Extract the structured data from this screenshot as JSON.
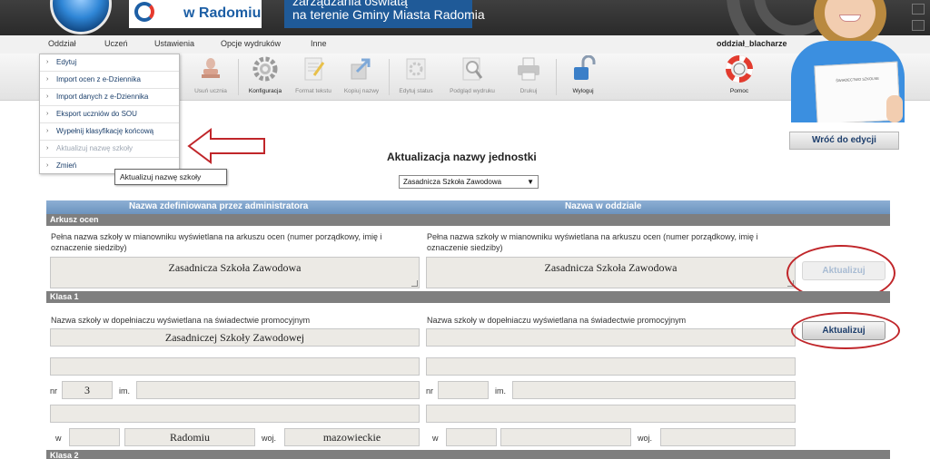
{
  "banner": {
    "logo_text": "w Radomiu",
    "line1": "zarządzania oświatą",
    "line2": "na terenie Gminy Miasta Radomia"
  },
  "menu": {
    "items": [
      "Oddział",
      "Uczeń",
      "Ustawienia",
      "Opcje wydruków",
      "Inne"
    ],
    "user": "oddział_blacharze"
  },
  "toolbar": {
    "tools": [
      {
        "label": "Usuń ucznia",
        "icon": "stamp-icon",
        "enabled": false
      },
      {
        "label": "Konfiguracja",
        "icon": "gear-icon",
        "enabled": true
      },
      {
        "label": "Format tekstu",
        "icon": "text-format-icon",
        "enabled": false
      },
      {
        "label": "Kopiuj nazwy",
        "icon": "copy-arrow-icon",
        "enabled": false
      },
      {
        "label": "Edytuj status",
        "icon": "gear-status-icon",
        "enabled": false
      },
      {
        "label": "Podgląd wydruku",
        "icon": "magnifier-icon",
        "enabled": false
      },
      {
        "label": "Drukuj",
        "icon": "printer-icon",
        "enabled": false
      },
      {
        "label": "Wyloguj",
        "icon": "padlock-icon",
        "enabled": true
      },
      {
        "label": "Pomoc",
        "icon": "lifebuoy-icon",
        "enabled": true
      }
    ]
  },
  "photo": {
    "doc_title": "ŚWIADECTWO SZKOLNE"
  },
  "dropdown": {
    "items": [
      {
        "label": "Edytuj",
        "enabled": true
      },
      {
        "label": "Import ocen z e-Dziennika",
        "enabled": true
      },
      {
        "label": "Import danych z e-Dziennika",
        "enabled": true
      },
      {
        "label": "Eksport uczniów do SOU",
        "enabled": true
      },
      {
        "label": "Wypełnij klasyfikację końcową",
        "enabled": true
      },
      {
        "label": "Aktualizuj nazwę szkoły",
        "enabled": false
      },
      {
        "label": "Zmień",
        "enabled": true
      }
    ],
    "tooltip": "Aktualizuj nazwę szkoły"
  },
  "main": {
    "back_button": "Wróć do edycji",
    "title": "Aktualizacja nazwy jednostki",
    "school_select": "Zasadnicza Szkoła Zawodowa",
    "col_admin": "Nazwa zdefiniowana przez administratora",
    "col_branch": "Nazwa w oddziale",
    "sections": {
      "arkusz": "Arkusz ocen",
      "klasa1": "Klasa 1",
      "klasa2": "Klasa 2"
    },
    "arkusz_label": "Pełna nazwa szkoły w mianowniku wyświetlana na arkuszu ocen (numer porządkowy, imię i oznaczenie siedziby)",
    "arkusz_admin_value": "Zasadnicza Szkoła Zawodowa",
    "arkusz_branch_value": "Zasadnicza Szkoła Zawodowa",
    "klasa1_label": "Nazwa szkoły w dopełniaczu wyświetlana na świadectwie promocyjnym",
    "klasa1_admin_value": "Zasadniczej Szkoły Zawodowej",
    "klasa1_branch_value": "",
    "nr_label": "nr",
    "im_label": "im.",
    "w_label": "w",
    "woj_label": "woj.",
    "admin_nr": "3",
    "admin_city": "Radomiu",
    "admin_voiv": "mazowieckie",
    "update_button": "Aktualizuj"
  },
  "colors": {
    "header_blue": "#6c93be",
    "section_gray": "#7f7f7f",
    "annotation_red": "#c0262a",
    "link_blue": "#1d3e6c"
  }
}
